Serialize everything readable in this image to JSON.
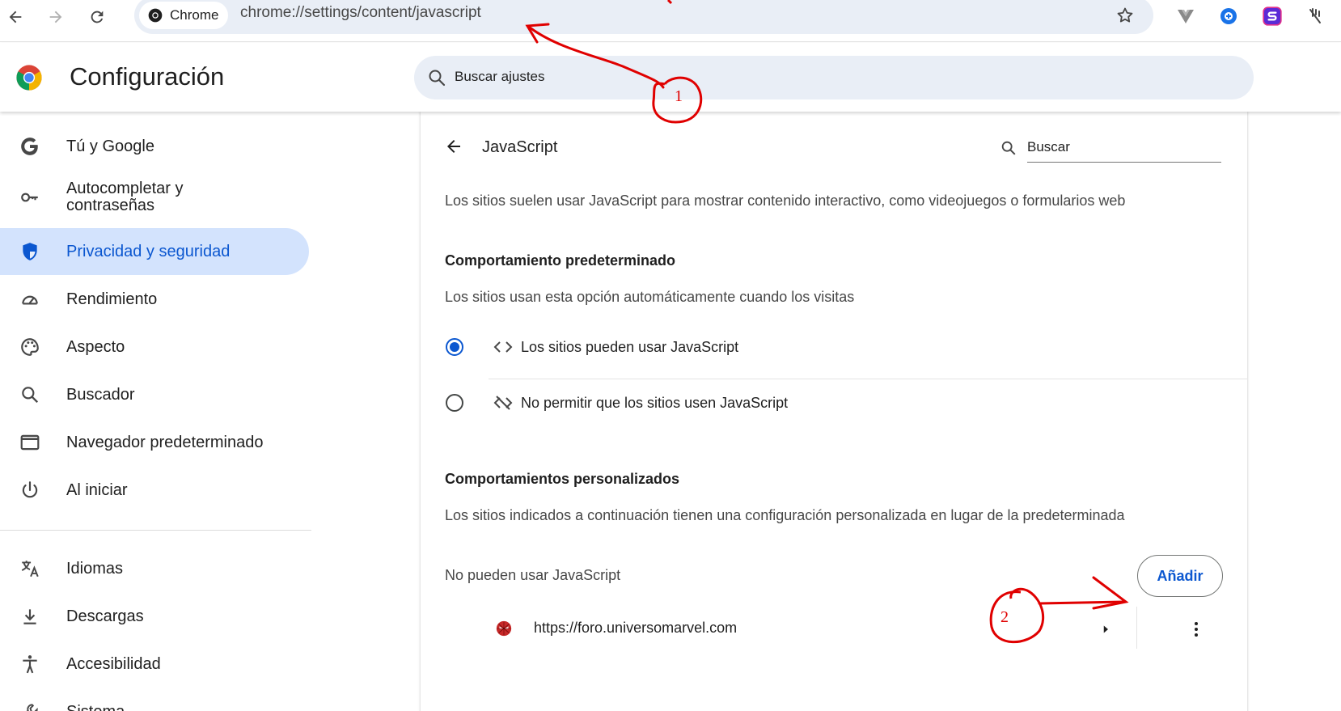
{
  "browser": {
    "chip_label": "Chrome",
    "url": "chrome://settings/content/javascript"
  },
  "settings": {
    "title": "Configuración",
    "search_placeholder": "Buscar ajustes"
  },
  "sidebar": {
    "items": [
      {
        "label": "Tú y Google",
        "icon": "google-g-icon"
      },
      {
        "label": "Autocompletar y contraseñas",
        "icon": "key-icon"
      },
      {
        "label": "Privacidad y seguridad",
        "icon": "shield-icon",
        "active": true
      },
      {
        "label": "Rendimiento",
        "icon": "speedometer-icon"
      },
      {
        "label": "Aspecto",
        "icon": "palette-icon"
      },
      {
        "label": "Buscador",
        "icon": "search-icon"
      },
      {
        "label": "Navegador predeterminado",
        "icon": "browser-window-icon"
      },
      {
        "label": "Al iniciar",
        "icon": "power-icon"
      },
      {
        "label": "Idiomas",
        "icon": "translate-icon"
      },
      {
        "label": "Descargas",
        "icon": "download-icon"
      },
      {
        "label": "Accesibilidad",
        "icon": "accessibility-icon"
      },
      {
        "label": "Sistema",
        "icon": "wrench-icon"
      }
    ]
  },
  "page": {
    "title": "JavaScript",
    "search_placeholder": "Buscar",
    "intro": "Los sitios suelen usar JavaScript para mostrar contenido interactivo, como videojuegos o formularios web",
    "default_heading": "Comportamiento predeterminado",
    "default_desc": "Los sitios usan esta opción automáticamente cuando los visitas",
    "option_allow": "Los sitios pueden usar JavaScript",
    "option_block": "No permitir que los sitios usen JavaScript",
    "selected_option": "allow",
    "custom_heading": "Comportamientos personalizados",
    "custom_desc": "Los sitios indicados a continuación tienen una configuración personalizada en lugar de la predeterminada",
    "blocked_heading": "No pueden usar JavaScript",
    "add_label": "Añadir",
    "blocked_sites": [
      {
        "url": "https://foro.universomarvel.com"
      }
    ]
  },
  "annotations": {
    "one": "1",
    "two": "2",
    "color": "#e00000"
  },
  "colors": {
    "accent": "#0b57d0",
    "active_nav_bg": "#d3e3fd",
    "search_bg": "#e9eef6"
  }
}
